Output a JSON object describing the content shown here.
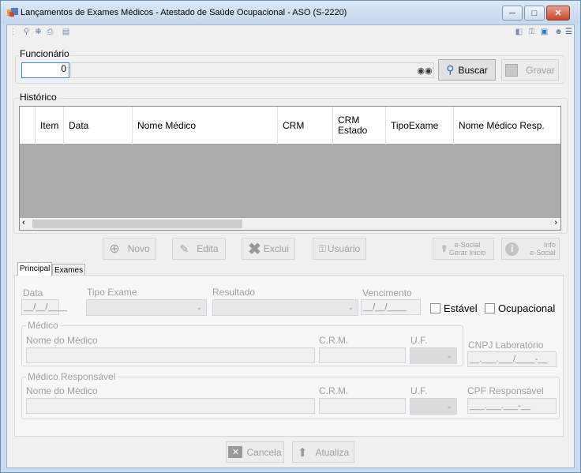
{
  "window": {
    "title": "Lançamentos de Exames Médicos - Atestado de Saúde Ocupacional - ASO (S-2220)"
  },
  "funcionario": {
    "label": "Funcionário",
    "code_value": "0",
    "buscar_label": "Buscar",
    "gravar_label": "Gravar"
  },
  "historico": {
    "label": "Histórico",
    "columns": [
      "Item",
      "Data",
      "Nome Médico",
      "CRM",
      "CRM Estado",
      "TipoExame",
      "Nome Médico Resp."
    ]
  },
  "actions": {
    "novo": "Novo",
    "edita": "Edita",
    "exclui": "Exclui",
    "usuario": "Usuário",
    "esocial_gerar_1": "e-Social",
    "esocial_gerar_2": "Gerar Inicio",
    "info_esocial_1": "Info",
    "info_esocial_2": "e-Social"
  },
  "tabs": [
    "Principal",
    "Exames"
  ],
  "principal": {
    "data_label": "Data",
    "data_value": "__/__/____",
    "tipo_exame_label": "Tipo Exame",
    "resultado_label": "Resultado",
    "vencimento_label": "Vencimento",
    "vencimento_value": "__/__/____",
    "estavel_label": "Estável",
    "ocupacional_label": "Ocupacional",
    "medico_group": "Médico",
    "nome_medico_label": "Nome do Médico",
    "crm_label": "C.R.M.",
    "uf_label": "U.F.",
    "cnpj_label": "CNPJ Laboratório",
    "cnpj_value": "__.___.___/____-__",
    "medico_resp_group": "Médico Responsável",
    "nome_medico_resp_label": "Nome do Médico",
    "crm_resp_label": "C.R.M.",
    "uf_resp_label": "U.F.",
    "cpf_label": "CPF Responsável",
    "cpf_value": "___.___.___-__"
  },
  "footer": {
    "cancela": "Cancela",
    "atualiza": "Atualiza"
  }
}
